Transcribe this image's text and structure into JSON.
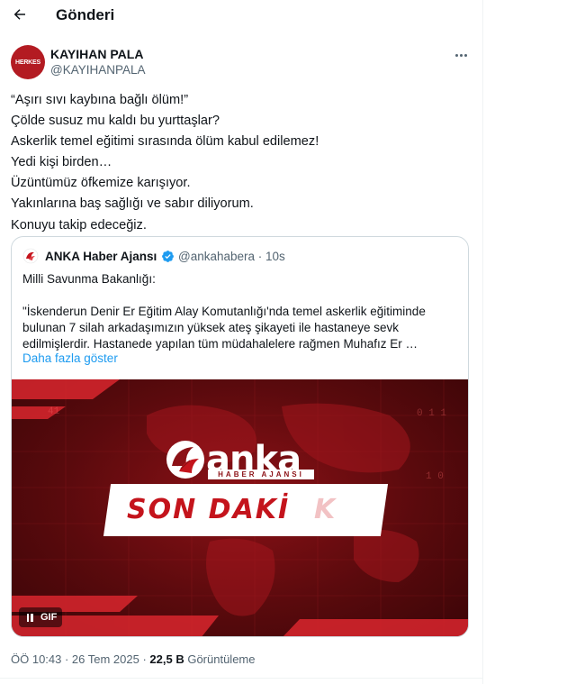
{
  "header": {
    "title": "Gönderi",
    "back_icon": "arrow-left-icon"
  },
  "author": {
    "name": "KAYIHAN PALA",
    "handle": "@KAYIHANPALA",
    "avatar_text": "HERKES"
  },
  "tweet": {
    "text": "“Aşırı sıvı kaybına bağlı ölüm!”\nÇölde susuz mu kaldı bu yurttaşlar?\nAskerlik temel eğitimi sırasında ölüm kabul edilemez!\nYedi kişi birden…\nÜzüntümüz öfkemize karışıyor.\nYakınlarına baş sağlığı ve sabır diliyorum.\nKonuyu takip edeceğiz."
  },
  "quote": {
    "name": "ANKA Haber Ajansı",
    "handle_time": "@ankahabera · 10s",
    "text": "Milli Savunma Bakanlığı:\n\n\"İskenderun Denir Er Eğitim Alay Komutanlığı'nda temel askerlik eğitiminde bulunan 7 silah arkadaşımızın yüksek ateş şikayeti ile hastaneye sevk edilmişlerdir. Hastanede yapılan tüm müdahalelere rağmen Muhafız Er …",
    "show_more": "Daha fazla göster",
    "media": {
      "logo_word": "anka",
      "logo_sub": "HABER AJANSI",
      "banner_text": "SON DAKİ",
      "banner_fade": "K",
      "gif_label": "GIF"
    }
  },
  "meta": {
    "time": "ÖÖ 10:43 · 26 Tem 2025 · ",
    "views_count": "22,5 B",
    "views_label": " Görüntüleme"
  },
  "colors": {
    "accent": "#1d9bf0",
    "brand_red": "#c4141c",
    "muted": "#536471"
  }
}
